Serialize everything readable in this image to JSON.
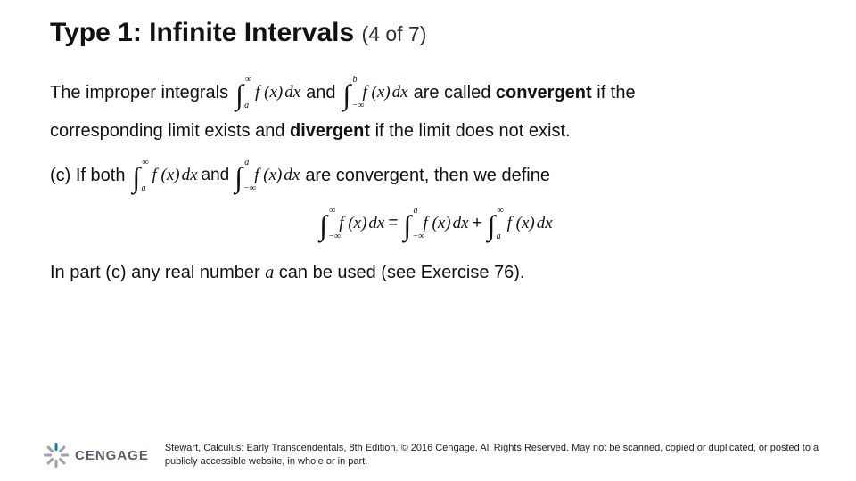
{
  "title": {
    "main": "Type 1: Infinite Intervals",
    "pager": "(4 of 7)"
  },
  "para1": {
    "t1": "The improper integrals",
    "int1": {
      "lo": "a",
      "up": "∞",
      "body": "f (x)",
      "dx": "dx"
    },
    "and": "and",
    "int2": {
      "lo": "−∞",
      "up": "b",
      "body": "f (x)",
      "dx": "dx"
    },
    "t2_a": "are called ",
    "t2_b": "convergent",
    "t2_c": " if the"
  },
  "para1b": {
    "t1_a": "corresponding limit exists and ",
    "t1_b": "divergent",
    "t1_c": " if the limit does not exist."
  },
  "para2": {
    "t1": "(c) If both",
    "int1": {
      "lo": "a",
      "up": "∞",
      "body": "f (x)",
      "dx": "dx"
    },
    "and": "and",
    "int2": {
      "lo": "−∞",
      "up": "a",
      "body": "f (x)",
      "dx": "dx"
    },
    "t2": "are convergent, then we define"
  },
  "eqn": {
    "lhs": {
      "lo": "−∞",
      "up": "∞",
      "body": "f (x)",
      "dx": "dx"
    },
    "eq": "=",
    "r1": {
      "lo": "−∞",
      "up": "a",
      "body": "f (x)",
      "dx": "dx"
    },
    "plus": "+",
    "r2": {
      "lo": "a",
      "up": "∞",
      "body": "f (x)",
      "dx": "dx"
    }
  },
  "para3": {
    "t1": "In part (c) any real number ",
    "a": "a",
    "t2": " can be used (see Exercise 76)."
  },
  "footer": {
    "brand": "CENGAGE",
    "copy": "Stewart, Calculus: Early Transcendentals, 8th Edition. © 2016 Cengage. All Rights Reserved. May not be scanned, copied or duplicated, or posted to a publicly accessible website, in whole or in part."
  }
}
